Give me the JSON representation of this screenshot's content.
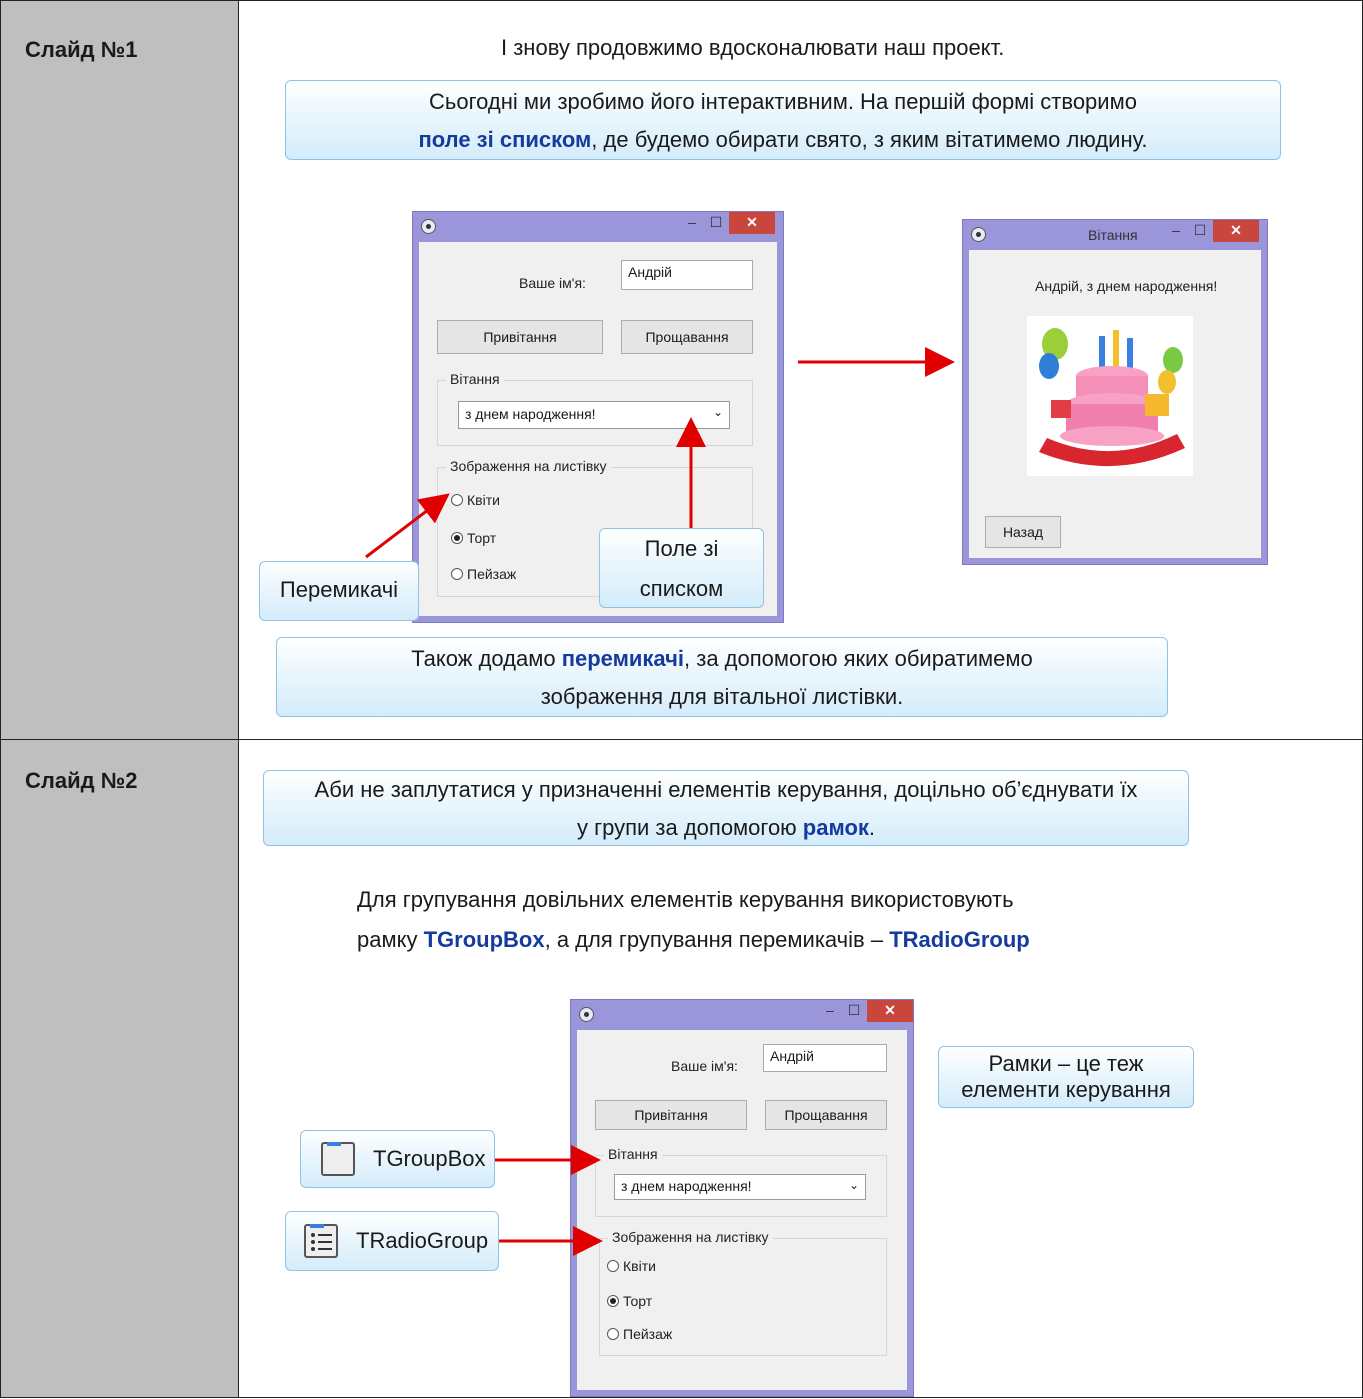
{
  "slides": [
    {
      "label": "Слайд №1",
      "intro": "І знову продовжимо вдосконалювати наш проект.",
      "callout1": {
        "line1": "Сьогодні ми зробимо його інтерактивним. На першій формі створимо",
        "highlight": "поле зі списком",
        "line2_rest": ", де будемо обирати свято, з яким вітатимемо людину."
      },
      "form": {
        "name_label": "Ваше ім'я:",
        "name_value": "Андрій",
        "btn_greet": "Привітання",
        "btn_bye": "Прощавання",
        "group_greeting": "Вітання",
        "combo_value": "з днем народження!",
        "group_picture": "Зображення на листівку",
        "radio_options": [
          "Квіти",
          "Торт",
          "Пейзаж"
        ],
        "radio_selected": "Торт"
      },
      "result_window": {
        "title": "Вітання",
        "message": "Андрій, з днем народження!",
        "back_button": "Назад"
      },
      "tag_radios": "Перемикачі",
      "tag_combo_line1": "Поле зі",
      "tag_combo_line2": "списком",
      "callout2": {
        "pre": "Також додамо ",
        "highlight": "перемикачі",
        "post": ", за допомогою яких обиратимемо",
        "line2": "зображення для вітальної листівки."
      }
    },
    {
      "label": "Слайд №2",
      "callout1": {
        "line1": "Аби не заплутатися у призначенні елементів керування, доцільно об’єднувати їх",
        "line2_pre": "у групи за допомогою ",
        "highlight": "рамок",
        "line2_post": "."
      },
      "text": {
        "line1": "Для групування довільних елементів керування використовують",
        "line2_pre": "рамку ",
        "hl1": "TGroupBox",
        "line2_mid": ", а для групування перемикачів – ",
        "hl2": "TRadioGroup"
      },
      "note_line1": "Рамки – це теж",
      "note_line2": "елементи керування",
      "tool_groupbox": "TGroupBox",
      "tool_radiogroup": "TRadioGroup"
    }
  ],
  "colors": {
    "highlight": "#153b9c",
    "arrow": "#e00000",
    "window_frame": "#9b96d9",
    "close_button": "#c9463d"
  },
  "icons": [
    "app-icon",
    "minimize-icon",
    "maximize-icon",
    "close-icon",
    "chevron-down-icon",
    "groupbox-icon",
    "radiogroup-icon"
  ]
}
